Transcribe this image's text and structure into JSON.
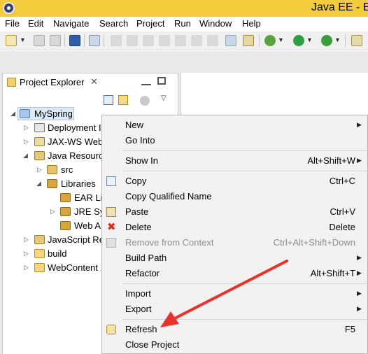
{
  "window": {
    "title": "Java EE - Ec"
  },
  "menubar": {
    "items": [
      "File",
      "Edit",
      "Navigate",
      "Search",
      "Project",
      "Run",
      "Window",
      "Help"
    ]
  },
  "project_explorer": {
    "title": "Project Explorer",
    "close_glyph": "✕",
    "tree": [
      {
        "label": "MySpring",
        "icon": "web-project-icon",
        "expanded": true,
        "selected": true
      },
      {
        "label": "Deployment I",
        "icon": "deployment-descriptor-icon",
        "expanded": false
      },
      {
        "label": "JAX-WS Web",
        "icon": "jaxws-icon",
        "expanded": false
      },
      {
        "label": "Java Resourc",
        "icon": "java-resources-icon",
        "expanded": true
      },
      {
        "label": "src",
        "icon": "source-folder-icon",
        "expanded": false
      },
      {
        "label": "Libraries",
        "icon": "libraries-icon",
        "expanded": true
      },
      {
        "label": "EAR Lil",
        "icon": "library-icon",
        "expanded": false
      },
      {
        "label": "JRE Sy",
        "icon": "library-icon",
        "expanded": false
      },
      {
        "label": "Web A",
        "icon": "library-icon",
        "expanded": false
      },
      {
        "label": "JavaScript Re",
        "icon": "javascript-resources-icon",
        "expanded": false
      },
      {
        "label": "build",
        "icon": "folder-icon",
        "expanded": false
      },
      {
        "label": "WebContent",
        "icon": "folder-icon",
        "expanded": false
      }
    ]
  },
  "context_menu": {
    "items": [
      {
        "label": "New",
        "shortcut": "",
        "submenu": true
      },
      {
        "label": "Go Into",
        "shortcut": "",
        "submenu": false
      },
      {
        "label": "Show In",
        "shortcut": "Alt+Shift+W",
        "submenu": true
      },
      {
        "label": "Copy",
        "shortcut": "Ctrl+C",
        "submenu": false,
        "icon": "copy-icon"
      },
      {
        "label": "Copy Qualified Name",
        "shortcut": "",
        "submenu": false
      },
      {
        "label": "Paste",
        "shortcut": "Ctrl+V",
        "submenu": false,
        "icon": "paste-icon"
      },
      {
        "label": "Delete",
        "shortcut": "Delete",
        "submenu": false,
        "icon": "delete-icon"
      },
      {
        "label": "Remove from Context",
        "shortcut": "Ctrl+Alt+Shift+Down",
        "submenu": false,
        "disabled": true,
        "icon": "remove-context-icon"
      },
      {
        "label": "Build Path",
        "shortcut": "",
        "submenu": true
      },
      {
        "label": "Refactor",
        "shortcut": "Alt+Shift+T",
        "submenu": true
      },
      {
        "label": "Import",
        "shortcut": "",
        "submenu": true
      },
      {
        "label": "Export",
        "shortcut": "",
        "submenu": true
      },
      {
        "label": "Refresh",
        "shortcut": "F5",
        "submenu": false,
        "icon": "refresh-icon"
      },
      {
        "label": "Close Project",
        "shortcut": "",
        "submenu": false
      }
    ],
    "arrow_glyph": "▶"
  },
  "colors": {
    "titlebar": "#f4cb3d",
    "selection": "#d9ebf9",
    "annotation_arrow": "#e8322b",
    "menu_background": "#f2f2f2"
  }
}
